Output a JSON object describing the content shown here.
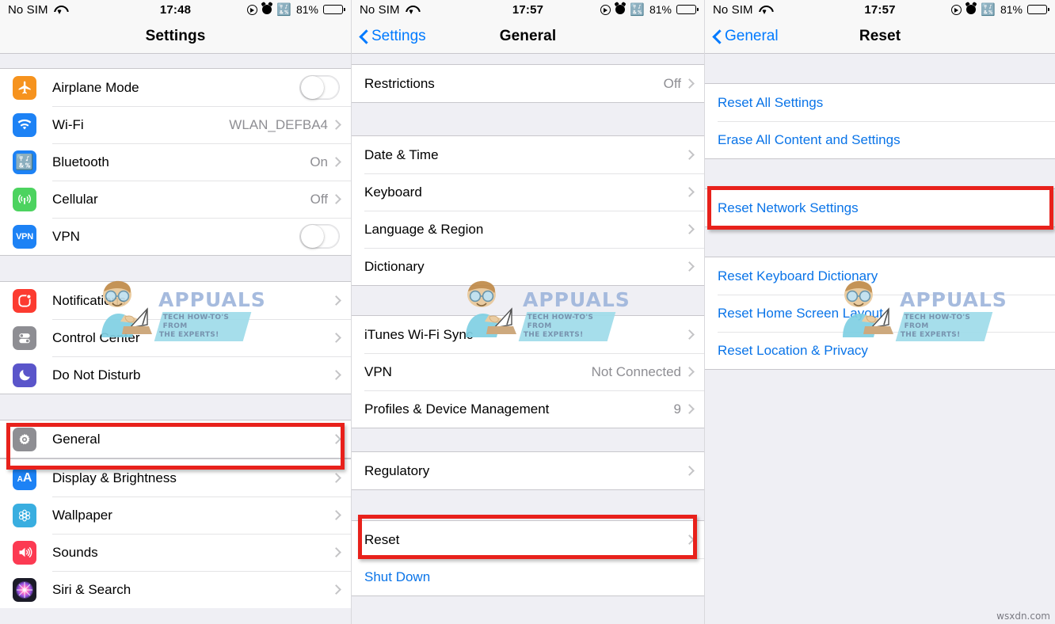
{
  "panels": [
    {
      "status": {
        "carrier": "No SIM",
        "time": "17:48",
        "battery_percent": "81%",
        "icons": [
          "wifi-icon",
          "location-icon",
          "alarm-icon",
          "bluetooth-icon",
          "battery-icon"
        ]
      },
      "nav": {
        "title": "Settings",
        "back": null
      },
      "groups": [
        {
          "top_gap": 18,
          "rows": [
            {
              "label": "Airplane Mode",
              "icon": "airplane-icon",
              "icon_color": "#f6931e",
              "control": "toggle"
            },
            {
              "label": "Wi-Fi",
              "icon": "wifi-icon",
              "icon_color": "#1d82f5",
              "value": "WLAN_DEFBA4",
              "control": "chevron"
            },
            {
              "label": "Bluetooth",
              "icon": "bluetooth-icon",
              "icon_color": "#1d82f5",
              "value": "On",
              "control": "chevron"
            },
            {
              "label": "Cellular",
              "icon": "cellular-icon",
              "icon_color": "#4cd35f",
              "value": "Off",
              "control": "chevron"
            },
            {
              "label": "VPN",
              "icon": "vpn-icon",
              "icon_color": "#1d82f5",
              "control": "toggle"
            }
          ]
        },
        {
          "top_gap": 32,
          "rows": [
            {
              "label": "Notifications",
              "icon": "notifications-icon",
              "icon_color": "#fc3b30",
              "control": "chevron"
            },
            {
              "label": "Control Center",
              "icon": "control-center-icon",
              "icon_color": "#8e8e93",
              "control": "chevron"
            },
            {
              "label": "Do Not Disturb",
              "icon": "do-not-disturb-icon",
              "icon_color": "#5a55ca",
              "control": "chevron"
            }
          ]
        },
        {
          "top_gap": 32,
          "rows": [
            {
              "label": "General",
              "icon": "gear-icon",
              "icon_color": "#8e8e93",
              "control": "chevron",
              "highlighted": true
            }
          ]
        },
        {
          "top_gap": 0,
          "rows": [
            {
              "label": "Display & Brightness",
              "icon": "display-brightness-icon",
              "icon_color": "#1d82f5",
              "control": "chevron"
            },
            {
              "label": "Wallpaper",
              "icon": "wallpaper-icon",
              "icon_color": "#39aee0",
              "control": "chevron"
            },
            {
              "label": "Sounds",
              "icon": "sounds-icon",
              "icon_color": "#fc3a52",
              "control": "chevron"
            },
            {
              "label": "Siri & Search",
              "icon": "siri-icon",
              "icon_color": "#1b1b28",
              "control": "chevron"
            }
          ]
        }
      ]
    },
    {
      "status": {
        "carrier": "No SIM",
        "time": "17:57",
        "battery_percent": "81%",
        "icons": [
          "wifi-icon",
          "location-icon",
          "alarm-icon",
          "bluetooth-icon",
          "battery-icon"
        ]
      },
      "nav": {
        "title": "General",
        "back": "Settings"
      },
      "groups": [
        {
          "top_gap": 18,
          "rows": [
            {
              "label": "Restrictions",
              "value": "Off",
              "control": "chevron"
            }
          ]
        },
        {
          "top_gap": 32,
          "rows": [
            {
              "label": "Date & Time",
              "control": "chevron"
            },
            {
              "label": "Keyboard",
              "control": "chevron"
            },
            {
              "label": "Language & Region",
              "control": "chevron"
            },
            {
              "label": "Dictionary",
              "control": "chevron"
            }
          ]
        },
        {
          "top_gap": 28,
          "rows": [
            {
              "label": "iTunes Wi-Fi Sync",
              "control": "chevron"
            },
            {
              "label": "VPN",
              "value": "Not Connected",
              "control": "chevron"
            },
            {
              "label": "Profiles & Device Management",
              "value": "9",
              "control": "chevron"
            }
          ]
        },
        {
          "top_gap": 26,
          "rows": [
            {
              "label": "Regulatory",
              "control": "chevron"
            }
          ]
        },
        {
          "top_gap": 28,
          "rows": [
            {
              "label": "Reset",
              "control": "chevron",
              "highlighted": true
            },
            {
              "label": "Shut Down",
              "control": "none",
              "blue": true
            }
          ]
        }
      ]
    },
    {
      "status": {
        "carrier": "No SIM",
        "time": "17:57",
        "battery_percent": "81%",
        "icons": [
          "wifi-icon",
          "location-icon",
          "alarm-icon",
          "bluetooth-icon",
          "battery-icon"
        ]
      },
      "nav": {
        "title": "Reset",
        "back": "General"
      },
      "groups": [
        {
          "top_gap": 36,
          "rows": [
            {
              "label": "Reset All Settings",
              "control": "none",
              "blue": true
            },
            {
              "label": "Erase All Content and Settings",
              "control": "none",
              "blue": true
            }
          ]
        },
        {
          "top_gap": 36,
          "rows": [
            {
              "label": "Reset Network Settings",
              "control": "none",
              "blue": true,
              "highlighted": true
            }
          ]
        },
        {
          "top_gap": 36,
          "rows": [
            {
              "label": "Reset Keyboard Dictionary",
              "control": "none",
              "blue": true
            },
            {
              "label": "Reset Home Screen Layout",
              "control": "none",
              "blue": true
            },
            {
              "label": "Reset Location & Privacy",
              "control": "none",
              "blue": true
            }
          ]
        }
      ]
    }
  ],
  "watermarks": {
    "brand": "APPUALS",
    "tagline_line1": "TECH HOW-TO'S FROM",
    "tagline_line2": "THE EXPERTS!",
    "site": "wsxdn.com"
  },
  "colors": {
    "accent_blue": "#007aff",
    "link_blue": "#0a74e8",
    "highlight_red": "#e8211b",
    "group_bg": "#efeff4",
    "row_bg": "#ffffff",
    "secondary_text": "#8e8e93"
  }
}
